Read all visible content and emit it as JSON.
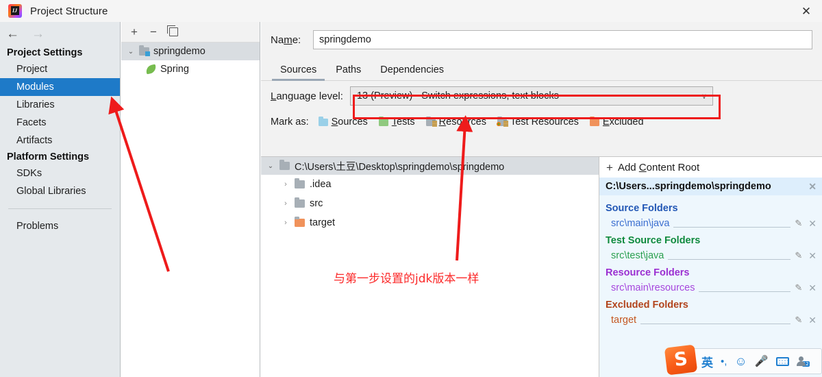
{
  "window": {
    "title": "Project Structure",
    "app_icon": "intellij-idea-icon",
    "close_label": "✕"
  },
  "sidebar": {
    "nav": {
      "back": "←",
      "forward": "→"
    },
    "sections": [
      {
        "title": "Project Settings",
        "items": [
          {
            "label": "Project",
            "selected": false
          },
          {
            "label": "Modules",
            "selected": true
          },
          {
            "label": "Libraries",
            "selected": false
          },
          {
            "label": "Facets",
            "selected": false
          },
          {
            "label": "Artifacts",
            "selected": false
          }
        ]
      },
      {
        "title": "Platform Settings",
        "items": [
          {
            "label": "SDKs",
            "selected": false
          },
          {
            "label": "Global Libraries",
            "selected": false
          }
        ]
      }
    ],
    "problems_label": "Problems"
  },
  "module_panel": {
    "toolbar": {
      "add": "+",
      "remove": "−",
      "copy_icon": "copy-icon"
    },
    "tree": [
      {
        "label": "springdemo",
        "icon": "module-folder-icon",
        "expander": "⌄",
        "selected": true
      },
      {
        "label": "Spring",
        "icon": "spring-leaf-icon",
        "selected": false
      }
    ]
  },
  "main": {
    "name_label_pre": "Na",
    "name_label_mnemonic": "m",
    "name_label_post": "e:",
    "name_value": "springdemo",
    "tabs": [
      {
        "label": "Sources",
        "active": true
      },
      {
        "label": "Paths",
        "active": false
      },
      {
        "label": "Dependencies",
        "active": false
      }
    ],
    "language_level": {
      "label_mnemonic": "L",
      "label_rest": "anguage level:",
      "value": "13 (Preview) - Switch expressions, text blocks",
      "chevron": "∨"
    },
    "mark_as": {
      "label": "Mark as:",
      "items": [
        {
          "label": "Sources",
          "mnemonic": "S",
          "rest": "ources",
          "color": "#9ad0e8",
          "variant": "plain"
        },
        {
          "label": "Tests",
          "mnemonic": "T",
          "rest": "ests",
          "color": "#90c97f",
          "variant": "plain"
        },
        {
          "label": "Resources",
          "mnemonic": "R",
          "rest": "esources",
          "color": "#a7afb6",
          "variant": "lines"
        },
        {
          "label": "Test Resources",
          "mnemonic": "",
          "rest": "Test Resources",
          "color": "#a7afb6",
          "variant": "dot"
        },
        {
          "label": "Excluded",
          "mnemonic": "E",
          "rest": "xcluded",
          "color": "#f0925b",
          "variant": "plain"
        }
      ]
    },
    "content_tree": {
      "root": {
        "label": "C:\\Users\\土豆\\Desktop\\springdemo\\springdemo",
        "expander": "⌄"
      },
      "children": [
        {
          "label": ".idea",
          "color": "#a7afb6",
          "expander": "›"
        },
        {
          "label": "src",
          "color": "#a7afb6",
          "expander": "›"
        },
        {
          "label": "target",
          "color": "#f0925b",
          "expander": "›"
        }
      ]
    },
    "roots_panel": {
      "add_content_root_pre": "Add ",
      "add_content_root_mn": "C",
      "add_content_root_post": "ontent Root",
      "plus": "+",
      "header": "C:\\Users...springdemo\\springdemo",
      "header_close": "✕",
      "groups": [
        {
          "title": "Source Folders",
          "color": "#2257b5",
          "entries": [
            {
              "path": "src\\main\\java",
              "color": "#3b6fd0"
            }
          ]
        },
        {
          "title": "Test Source Folders",
          "color": "#0f8a3d",
          "entries": [
            {
              "path": "src\\test\\java",
              "color": "#2ba04f"
            }
          ]
        },
        {
          "title": "Resource Folders",
          "color": "#9b2fd1",
          "entries": [
            {
              "path": "src\\main\\resources",
              "color": "#a646dd"
            }
          ]
        },
        {
          "title": "Excluded Folders",
          "color": "#b2441b",
          "entries": [
            {
              "path": "target",
              "color": "#c4561f"
            }
          ]
        }
      ],
      "edit_icon": "✎",
      "remove_icon": "✕"
    }
  },
  "annotations": {
    "highlight_box": "red-rectangle-language-level",
    "note_text": "与第一步设置的jdk版本一样",
    "arrow_to_modules": "red-arrow-to-modules",
    "arrow_to_language_level": "red-arrow-to-language-level",
    "color": "#ee1b1b"
  },
  "ime_toolbar": {
    "logo": "S",
    "mode": "英",
    "punctuation": "•,",
    "emoji": "☺",
    "mic": "mic-icon",
    "keyboard": "keyboard-icon",
    "user": "user-icon",
    "user_badge": "12"
  }
}
